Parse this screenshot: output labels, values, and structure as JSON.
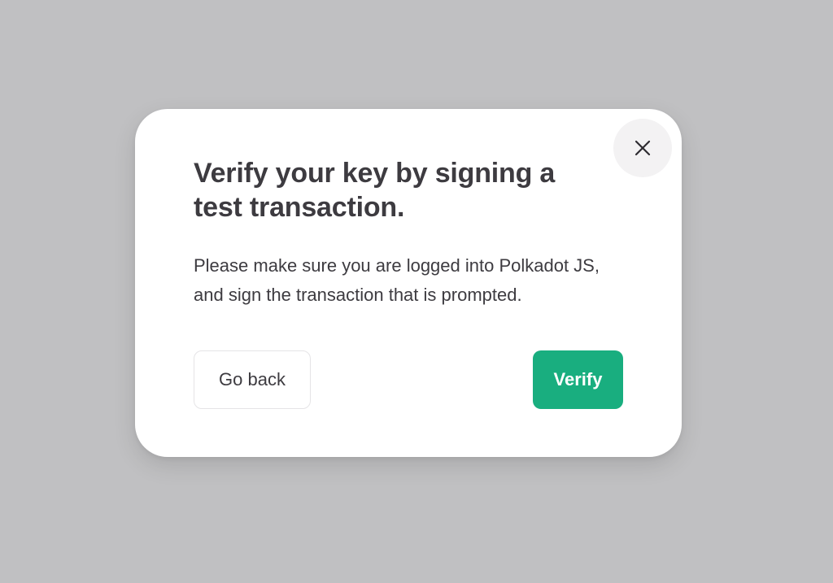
{
  "modal": {
    "title": "Verify your key by signing a test transaction.",
    "description": "Please make sure you are logged into Polkadot JS, and sign the transaction that is prompted.",
    "close_icon": "close-icon",
    "buttons": {
      "back_label": "Go back",
      "verify_label": "Verify"
    }
  },
  "colors": {
    "backdrop": "#c0c0c2",
    "modal_bg": "#ffffff",
    "text": "#3d3b40",
    "accent": "#19ae7f",
    "close_bg": "#f3f2f3"
  }
}
